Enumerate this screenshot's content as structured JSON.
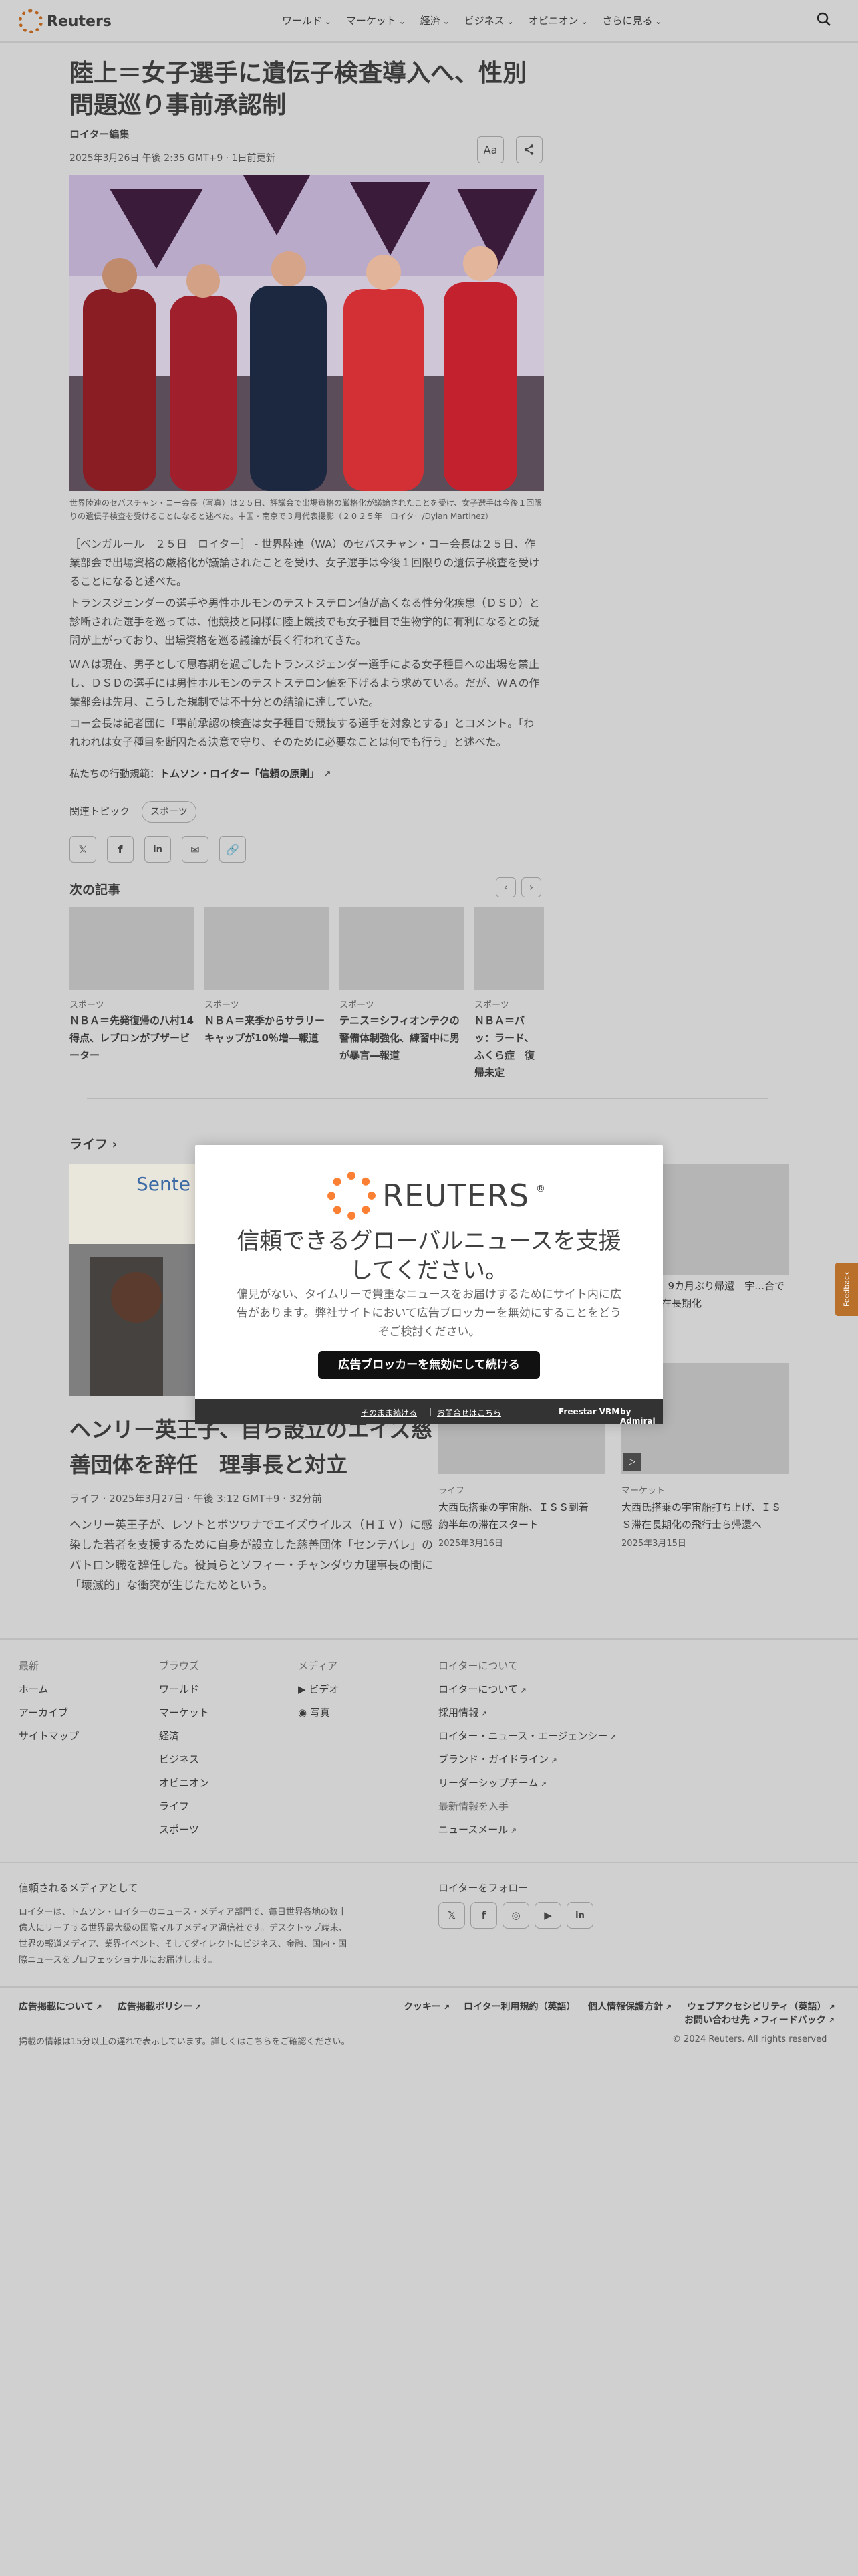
{
  "header": {
    "logo_text": "Reuters",
    "nav": [
      "ワールド",
      "マーケット",
      "経済",
      "ビジネス",
      "オピニオン",
      "さらに見る"
    ]
  },
  "article": {
    "headline": "陸上＝女子選手に遺伝子検査導入へ、性別問題巡り事前承認制",
    "byline": "ロイター編集",
    "date": "2025年3月26日 午後 2:35 GMT+9 · 1日前更新",
    "font_btn": "Aa",
    "photo_caption": "世界陸連のセバスチャン・コー会長（写真）は２５日、評議会で出場資格の厳格化が議論されたことを受け、女子選手は今後１回限りの遺伝子検査を受けることになると述べた。中国・南京で３月代表撮影（２０２５年　ロイター/Dylan Martinez）",
    "paragraphs": [
      "［ベンガルール　２５日　ロイター］ - 世界陸連（WA）のセバスチャン・コー会長は２５日、作業部会で出場資格の厳格化が議論されたことを受け、女子選手は今後１回限りの遺伝子検査を受けることになると述べた。",
      "トランスジェンダーの選手や男性ホルモンのテストステロン値が高くなる性分化疾患（ＤＳＤ）と診断された選手を巡っては、他競技と同様に陸上競技でも女子種目で生物学的に有利になるとの疑問が上がっており、出場資格を巡る議論が長く行われてきた。",
      "ＷＡは現在、男子として思春期を過ごしたトランスジェンダー選手による女子種目への出場を禁止し、ＤＳＤの選手には男性ホルモンのテストステロン値を下げるよう求めている。だが、ＷＡの作業部会は先月、こうした規制では不十分との結論に達していた。",
      "コー会長は記者団に「事前承認の検査は女子種目で競技する選手を対象とする」とコメント。「われわれは女子種目を断固たる決意で守り、そのために必要なことは何でも行う」と述べた。"
    ],
    "trust_prefix": "私たちの行動規範：",
    "trust_link": "トムソン・ロイター「信頼の原則」",
    "topic_label": "関連トピック",
    "topic_pill": "スポーツ"
  },
  "next": {
    "title": "次の記事",
    "cards": [
      {
        "cat": "スポーツ",
        "title": "ＮＢＡ＝先発復帰の八村14得点、レブロンがブザービーター"
      },
      {
        "cat": "スポーツ",
        "title": "ＮＢＡ＝来季からサラリーキャップが10％増―報道"
      },
      {
        "cat": "スポーツ",
        "title": "テニス＝シフィオンテクの警備体制強化、練習中に男が暴言―報道"
      },
      {
        "cat": "スポーツ",
        "title": "ＮＢＡ＝バッ：ラード、ふくら症　復帰未定"
      }
    ]
  },
  "life": {
    "title": "ライフ",
    "main_title": "ヘンリー英王子、自ら設立のエイズ慈善団体を辞任　理事長と対立",
    "main_meta": "ライフ · 2025年3月27日 · 午後 3:12 GMT+9 · 32分前",
    "main_desc": "ヘンリー英王子が、レソトとボツワナでエイズウイルス（ＨＩＶ）に感染した若者を支援するために自身が設立した慈善団体「センテバレ」のパトロン職を辞任した。役員らとソフィー・チャンダウカ理事長の間に「壊滅的」な衝突が生じたためという。",
    "side": [
      {
        "cat": "",
        "title": "…之2人、9カ月ぶり帰還　宇…合でＩＳＳ滞在長期化",
        "date": "…19日"
      },
      {
        "cat": "ライフ",
        "title": "大西氏搭乗の宇宙船、ＩＳＳ到着　約半年の滞在スタート",
        "date": "2025年3月16日"
      },
      {
        "cat": "マーケット",
        "title": "大西氏搭乗の宇宙船打ち上げ、ＩＳＳ滞在長期化の飛行士ら帰還へ",
        "date": "2025年3月15日"
      }
    ]
  },
  "modal": {
    "logo_text": "REUTERS",
    "title": "信頼できるグローバルニュースを支援してください。",
    "body": "偏見がない、タイムリーで貴重なニュースをお届けするためにサイト内に広告があります。弊社サイトにおいて広告ブロッカーを無効にすることをどうぞご検討ください。",
    "button": "広告ブロッカーを無効にして続ける",
    "continue": "そのまま続ける",
    "contact": "お問合せはこちら",
    "brand": "Freestar VRM",
    "brand_by": "by Admiral"
  },
  "feedback": "Feedback",
  "footer": {
    "col1": {
      "heading": "最新",
      "items": [
        "ホーム",
        "アーカイブ",
        "サイトマップ"
      ]
    },
    "col2": {
      "heading": "ブラウズ",
      "items": [
        "ワールド",
        "マーケット",
        "経済",
        "ビジネス",
        "オピニオン",
        "ライフ",
        "スポーツ"
      ]
    },
    "col3": {
      "heading": "メディア",
      "items": [
        "ビデオ",
        "写真"
      ]
    },
    "col4": {
      "heading": "ロイターについて",
      "items": [
        "ロイターについて",
        "採用情報",
        "ロイター・ニュース・エージェンシー",
        "ブランド・ガイドライン",
        "リーダーシップチーム"
      ]
    },
    "news_heading": "最新情報を入手",
    "news_item": "ニュースメール",
    "trust_heading": "信頼されるメディアとして",
    "trust_body": "ロイターは、トムソン・ロイターのニュース・メディア部門で、毎日世界各地の数十億人にリーチする世界最大級の国際マルチメディア通信社です。デスクトップ端末、世界の報道メディア、業界イベント、そしてダイレクトにビジネス、金融、国内・国際ニュースをプロフェッショナルにお届けします。",
    "follow_heading": "ロイターをフォロー",
    "legal_left": [
      "広告掲載について",
      "広告掲載ポリシー"
    ],
    "legal_right": [
      "クッキー",
      "ロイター利用規約（英語）",
      "個人情報保護方針",
      "ウェブアクセシビリティ（英語）"
    ],
    "legal_right2": [
      "お問い合わせ先",
      "フィードバック"
    ],
    "delay_note": "掲載の情報は15分以上の遅れで表示しています。詳しくはこちらをご確認ください。",
    "copyright": "© 2024 Reuters. All rights reserved"
  }
}
